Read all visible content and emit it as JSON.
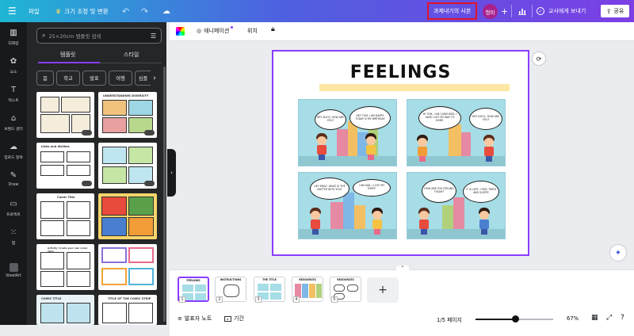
{
  "header": {
    "menu_icon": "hamburger-icon",
    "file_label": "파일",
    "resize_label": "크기 조정 및 변환",
    "copy_label": "과제내기의 사본",
    "avatar_label": "형미",
    "plus_label": "+",
    "send_label": "교사에게 보내기",
    "share_label": "공유"
  },
  "rail": {
    "items": [
      {
        "label": "디자인",
        "icon": "layout-icon"
      },
      {
        "label": "요소",
        "icon": "elements-icon"
      },
      {
        "label": "텍스트",
        "icon": "text-icon"
      },
      {
        "label": "브랜드 센터",
        "icon": "brand-icon"
      },
      {
        "label": "업로드 항목",
        "icon": "upload-icon"
      },
      {
        "label": "Draw",
        "icon": "draw-icon"
      },
      {
        "label": "프로젝트",
        "icon": "folder-icon"
      },
      {
        "label": "앱",
        "icon": "apps-icon"
      },
      {
        "label": "VoxelArt",
        "icon": "voxelart-icon"
      }
    ]
  },
  "panel": {
    "search_placeholder": "25×20cm 템플릿 검색",
    "tabs": [
      "템플릿",
      "스타일"
    ],
    "chips": [
      "봄",
      "학교",
      "발표",
      "여행",
      "심플"
    ],
    "thumb_captions": [
      "UNDERSTANDING DIVERSITY",
      "Likes and dislikes",
      "Comic Title",
      "Activity: Create your own comic story",
      "COMIC TITLE",
      "TITLE OF THE COMIC STRIP"
    ]
  },
  "toolbar": {
    "animation_label": "애니메이션",
    "position_label": "위치"
  },
  "canvas": {
    "title": "FEELINGS",
    "bubbles": [
      "HEY ALICE, HOW ARE YOU?",
      "HEY TOM, I AM HAPPY. TODAY IS MY BIRTHDAY.",
      "HI TOM, I AM CONFUSED. I HAVE LOST MY WAY TO HOME.",
      "HEY DOOL, HOW ARE YOU?",
      "HEY EMILY, WHAT IS THE MATTER WITH YOU?",
      "I AM SAD, I LOST MY PUPPY.",
      "HOW ARE YOU FEELING TODAY?",
      "IT IS LATE, I FEEL TIRED AND SLEEPY."
    ]
  },
  "pages": [
    {
      "num": "1",
      "title": "FEELINGS"
    },
    {
      "num": "2",
      "title": "INSTRUCTIONS"
    },
    {
      "num": "3",
      "title": "THE TITLE"
    },
    {
      "num": "4",
      "title": "RESOURCES"
    },
    {
      "num": "5",
      "title": "RESOURCES"
    }
  ],
  "footer": {
    "notes_label": "발표자 노트",
    "timer_label": "기간",
    "page_indicator": "1/5 페이지",
    "zoom": "67%",
    "zoom_value": 67
  },
  "colors": {
    "accent": "#8b3dff",
    "copy_outline": "#e0142b"
  }
}
